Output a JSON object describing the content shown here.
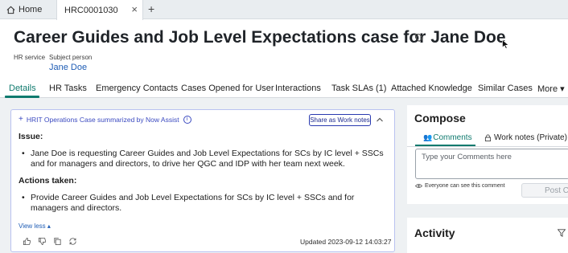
{
  "browser_tabs": {
    "home_label": "Home",
    "active_label": "HRC0001030",
    "close_glyph": "×",
    "add_glyph": "+"
  },
  "header": {
    "title": "Career Guides and Job Level Expectations case for Jane Doe",
    "hr_service_label": "HR service",
    "subject_person_label": "Subject person",
    "subject_person_value": "Jane Doe"
  },
  "record_tabs": [
    {
      "label": "Details",
      "active": true
    },
    {
      "label": "HR Tasks"
    },
    {
      "label": "Emergency Contacts"
    },
    {
      "label": "Cases Opened for User"
    },
    {
      "label": "Interactions"
    },
    {
      "label": "Task SLAs (1)"
    },
    {
      "label": "Attached Knowledge"
    },
    {
      "label": "Similar Cases"
    },
    {
      "label": "More ▾"
    }
  ],
  "summary": {
    "header_label": "HRIT Operations Case summarized by Now Assist",
    "share_button": "Share as Work notes",
    "issue_heading": "Issue:",
    "issue_bullet": "Jane Doe is requesting Career Guides and Job Level Expectations for SCs by IC level + SSCs and for managers and directors, to drive her QGC and IDP with her team next week.",
    "actions_heading": "Actions taken:",
    "actions_bullet": "Provide Career Guides and Job Level Expectations for SCs by IC level + SSCs and for managers and directors.",
    "view_less": "View less ▴",
    "updated": "Updated 2023-09-12 14:03:27"
  },
  "compose": {
    "title": "Compose",
    "tab_comments": "Comments",
    "tab_work_notes": "Work notes (Private)",
    "comment_placeholder": "Type your Comments here",
    "visibility_note": "Everyone can see this comment",
    "post_button": "Post C"
  },
  "activity": {
    "title": "Activity"
  },
  "colors": {
    "accent": "#0f7a6e",
    "link": "#1f5db5",
    "assist": "#3b4ac0"
  }
}
